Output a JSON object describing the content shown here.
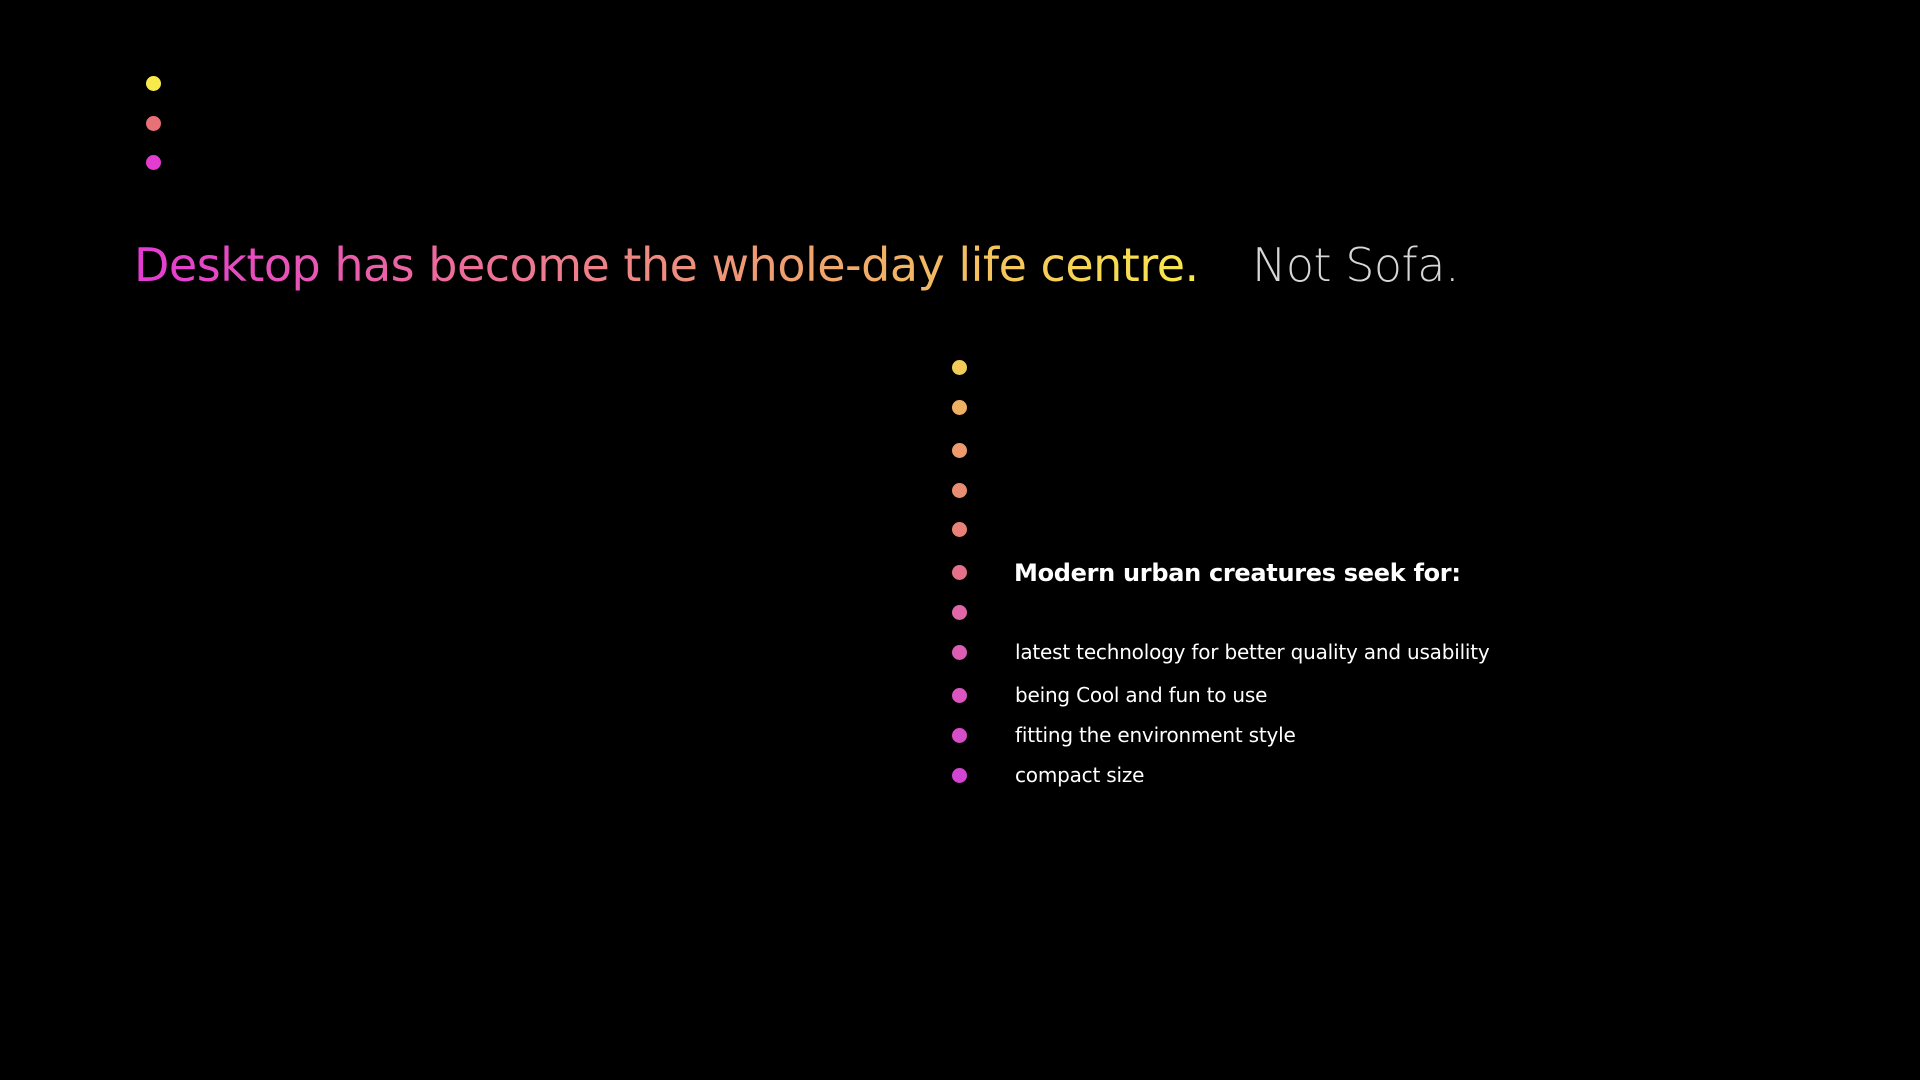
{
  "slide": {
    "headline": "Desktop has become the whole-day life centre.",
    "tagline": "Not Sofa.",
    "list_heading": "Modern urban creatures seek for:",
    "list_items": [
      "latest technology for better quality and usability",
      "being Cool and fun to use",
      "fitting the environment style",
      "compact size"
    ]
  },
  "colors": {
    "background": "#000000",
    "gradient": [
      "#e43bd4",
      "#ec6c9a",
      "#efa06f",
      "#f9e94a"
    ],
    "tagline": "#d7d7d7",
    "text": "#ffffff",
    "top_dots": [
      "#f8ea4b",
      "#ea7078",
      "#e43bd0"
    ],
    "right_dots": [
      "#f4cb5b",
      "#f0b063",
      "#ed9b6c",
      "#ea8c72",
      "#e98276",
      "#e6708a",
      "#e066a8",
      "#dd5db6",
      "#da55bf",
      "#d64dc8",
      "#d245d2"
    ]
  }
}
